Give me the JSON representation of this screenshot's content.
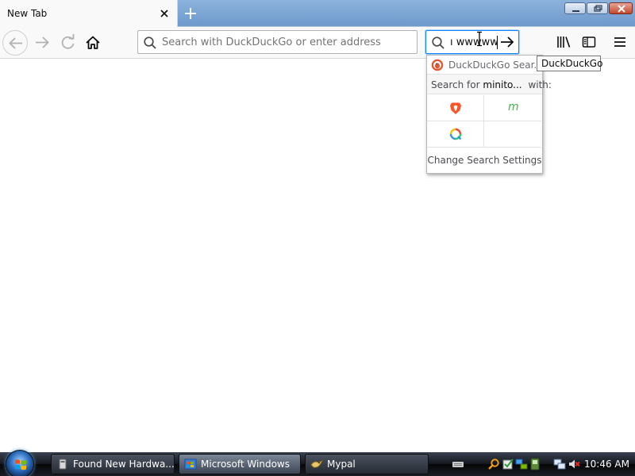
{
  "browser": {
    "tab": {
      "title": "New Tab"
    },
    "urlbar": {
      "placeholder": "Search with DuckDuckGo or enter address",
      "value": ""
    },
    "searchbar": {
      "value": "ı wwwww"
    },
    "tooltip": "DuckDuckGo"
  },
  "search_popup": {
    "engine_label": "DuckDuckGo Sear...",
    "header_prefix": "Search for",
    "header_term": "minito...",
    "header_suffix": "with:",
    "engines": [
      "brave-icon",
      "m-icon",
      "qwant-icon"
    ],
    "m_glyph": "m",
    "settings_label": "Change Search Settings"
  },
  "taskbar": {
    "items": [
      {
        "label": "Found New Hardwa..."
      },
      {
        "label": "Microsoft Windows"
      },
      {
        "label": "Mypal"
      }
    ],
    "clock": "10:46 AM"
  },
  "colors": {
    "accent_focus": "#0a84ff",
    "titlebar": "#7aa3d1",
    "toolbar": "#f9f9fa",
    "taskbar": "#15191f"
  }
}
